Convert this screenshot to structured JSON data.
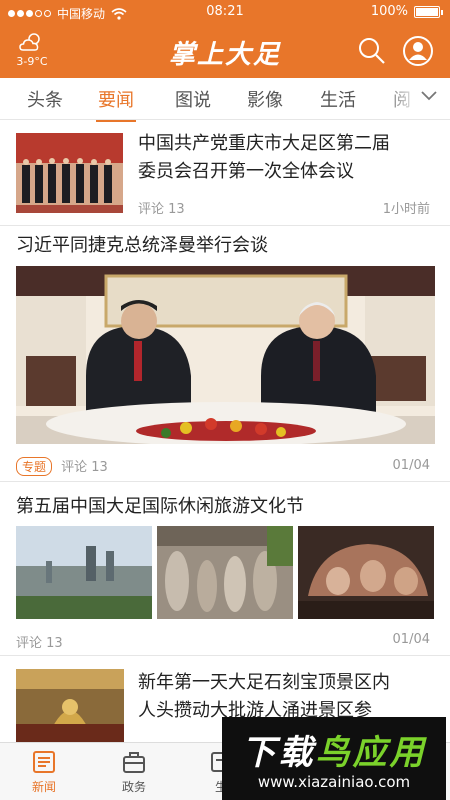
{
  "status_bar": {
    "carrier": "中国移动",
    "time": "08:21",
    "battery": "100%"
  },
  "header": {
    "weather_temp": "3-9°C",
    "logo": "掌上大足"
  },
  "tabs": [
    {
      "label": "头条"
    },
    {
      "label": "要闻"
    },
    {
      "label": "图说"
    },
    {
      "label": "影像"
    },
    {
      "label": "生活"
    },
    {
      "label": "阅"
    }
  ],
  "active_tab": "要闻",
  "news": {
    "item1": {
      "title_line1": "中国共产党重庆市大足区第二届",
      "title_line2": "委员会召开第一次全体会议",
      "comments": "评论 13",
      "time": "1小时前"
    },
    "item2": {
      "title": "习近平同捷克总统泽曼举行会谈",
      "tag": "专题",
      "comments": "评论 13",
      "page": "01/04"
    },
    "item3": {
      "title": "第五届中国大足国际休闲旅游文化节",
      "comments": "评论 13",
      "page": "01/04"
    },
    "item4": {
      "title_line1": "新年第一天大足石刻宝顶景区内",
      "title_line2": "人头攒动大批游人涌进景区参"
    }
  },
  "bottom_nav": [
    {
      "label": "新闻",
      "icon": "news-icon"
    },
    {
      "label": "政务",
      "icon": "briefcase-icon"
    },
    {
      "label": "生",
      "icon": "life-icon"
    }
  ],
  "watermark": {
    "title_a": "下载",
    "title_b": "鸟应用",
    "url": "www.xiazainiao.com"
  },
  "colors": {
    "accent": "#e8762a",
    "watermark_green": "#7bd22b"
  }
}
